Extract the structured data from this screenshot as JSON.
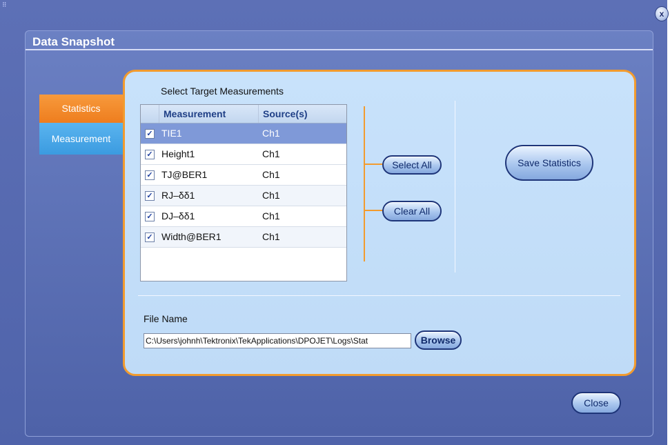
{
  "app": {
    "close_glyph": "x"
  },
  "dialog": {
    "title": "Data Snapshot"
  },
  "tabs": [
    {
      "label": "Statistics",
      "active": true,
      "color": "#f08a2a"
    },
    {
      "label": "Measurement",
      "active": false,
      "color": "#4aa8ea"
    }
  ],
  "panel": {
    "section_label": "Select Target Measurements",
    "table": {
      "columns": [
        "Measurement",
        "Source(s)"
      ],
      "rows": [
        {
          "measurement": "TIE1",
          "source": "Ch1",
          "checked": true,
          "selected": true
        },
        {
          "measurement": "Height1",
          "source": "Ch1",
          "checked": true,
          "selected": false
        },
        {
          "measurement": "TJ@BER1",
          "source": "Ch1",
          "checked": true,
          "selected": false
        },
        {
          "measurement": "RJ–δδ1",
          "source": "Ch1",
          "checked": true,
          "selected": false
        },
        {
          "measurement": "DJ–δδ1",
          "source": "Ch1",
          "checked": true,
          "selected": false
        },
        {
          "measurement": "Width@BER1",
          "source": "Ch1",
          "checked": true,
          "selected": false
        }
      ]
    },
    "select_all_label": "Select All",
    "clear_all_label": "Clear All",
    "save_statistics_label": "Save Statistics",
    "file_name_label": "File Name",
    "file_name_value": "C:\\Users\\johnh\\Tektronix\\TekApplications\\DPOJET\\Logs\\Stat",
    "browse_label": "Browse"
  },
  "footer": {
    "close_label": "Close"
  },
  "colors": {
    "accent_orange": "#f29b2e",
    "panel_bg": "#c8e2fb",
    "dialog_bg": "#5d70b6",
    "selected_row": "#7f99d8"
  }
}
